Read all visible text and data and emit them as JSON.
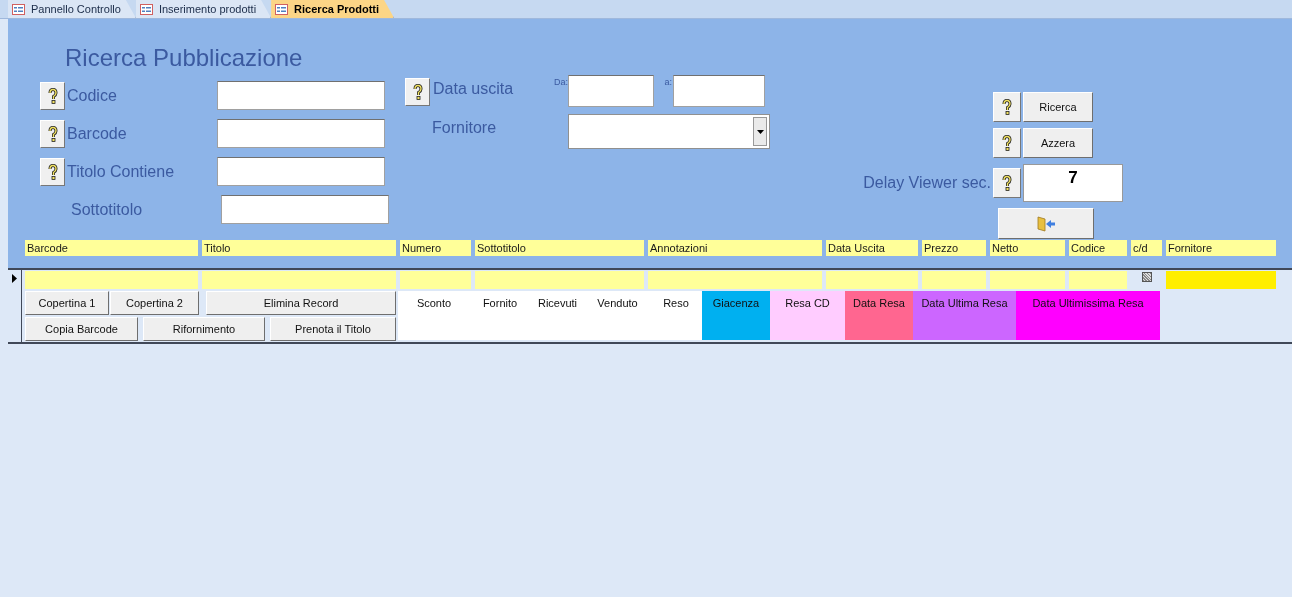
{
  "tabs": [
    {
      "label": "Pannello Controllo",
      "selected": false
    },
    {
      "label": "Inserimento prodotti",
      "selected": false
    },
    {
      "label": "Ricerca Prodotti",
      "selected": true
    }
  ],
  "form": {
    "title": "Ricerca Pubblicazione"
  },
  "search_fields": [
    {
      "label": "Codice",
      "help": true
    },
    {
      "label": "Barcode",
      "help": true
    },
    {
      "label": "Titolo Contiene",
      "help": true
    },
    {
      "label": "Sottotitolo",
      "help": false
    }
  ],
  "date_filter": {
    "label": "Data uscita",
    "help": true,
    "from_label": "Da:",
    "to_label": "a:"
  },
  "supplier": {
    "label": "Fornitore"
  },
  "buttons": [
    {
      "label": "Ricerca",
      "help": true
    },
    {
      "label": "Azzera",
      "help": true
    }
  ],
  "delay": {
    "label": "Delay Viewer sec.",
    "help": true,
    "value": "7"
  },
  "columns": [
    {
      "label": "Barcode",
      "kind": "field"
    },
    {
      "label": "Titolo",
      "kind": "field"
    },
    {
      "label": "Numero",
      "kind": "field"
    },
    {
      "label": "Sottotitolo",
      "kind": "field"
    },
    {
      "label": "Annotazioni",
      "kind": "field"
    },
    {
      "label": "Data Uscita",
      "kind": "field"
    },
    {
      "label": "Prezzo",
      "kind": "field"
    },
    {
      "label": "Netto",
      "kind": "field"
    },
    {
      "label": "Codice",
      "kind": "field"
    },
    {
      "label": "c/d",
      "kind": "checkbox",
      "indeterminate": true
    },
    {
      "label": "Fornitore",
      "kind": "lookup"
    }
  ],
  "record_buttons": [
    [
      "Copertina 1",
      "Copertina 2",
      "Elimina Record"
    ],
    [
      "Copia Barcode",
      "Rifornimento",
      "Prenota il Titolo"
    ]
  ],
  "stats": [
    {
      "label": "Sconto"
    },
    {
      "label": "Fornito"
    },
    {
      "label": "Ricevuti"
    },
    {
      "label": "Venduto"
    },
    {
      "label": "Reso"
    },
    {
      "label": "Giacenza",
      "color": "#00b0f0"
    },
    {
      "label": "Resa CD",
      "color": "#ffccff"
    },
    {
      "label": "Data Resa",
      "color": "#ff6690"
    },
    {
      "label": "Data Ultima Resa",
      "color": "#cc66ff"
    },
    {
      "label": "Data Ultimissima Resa",
      "color": "#ff00ff"
    }
  ]
}
